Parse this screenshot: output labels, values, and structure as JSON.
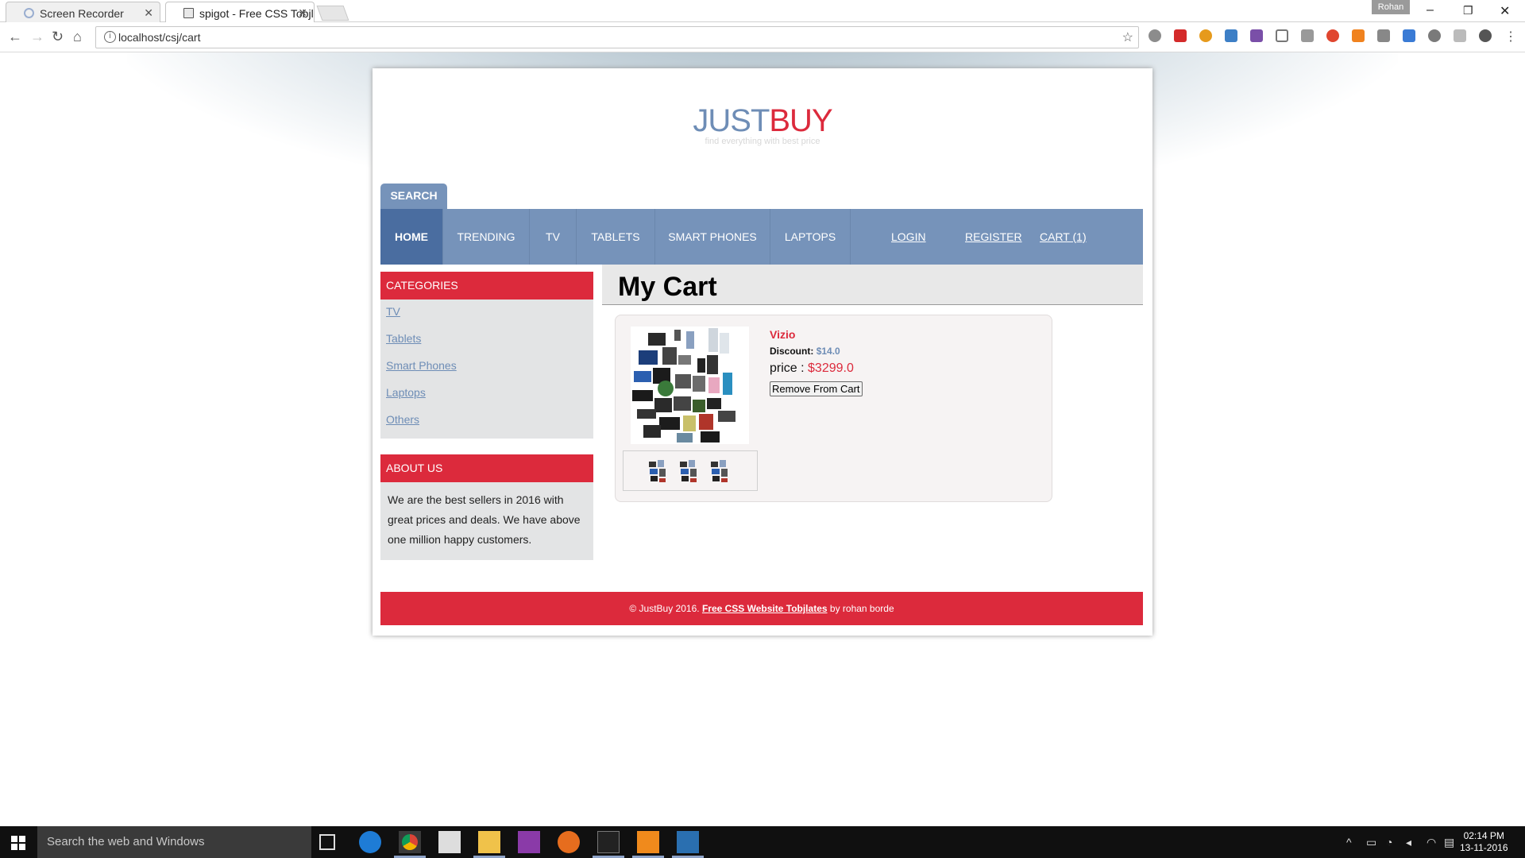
{
  "browser": {
    "tabs": [
      {
        "title": "Screen Recorder",
        "active": false
      },
      {
        "title": "spigot - Free CSS Tobjlat",
        "active": true
      }
    ],
    "profile": "Rohan",
    "url": "localhost/csj/cart"
  },
  "site": {
    "logo_part1": "JUST",
    "logo_part2": "BUY",
    "tagline": "find everything with best price",
    "search_label": "SEARCH",
    "menu": {
      "home": "HOME",
      "trending": "TRENDING",
      "tv": "TV",
      "tablets": "TABLETS",
      "smart_phones": "SMART PHONES",
      "laptops": "LAPTOPS",
      "login": "LOGIN",
      "register": "REGISTER",
      "cart": "CART (1)"
    },
    "sidebar": {
      "categories_title": "CATEGORIES",
      "categories": [
        "TV",
        "Tablets",
        "Smart Phones",
        "Laptops",
        "Others"
      ],
      "about_title": "ABOUT US",
      "about_text": "We are the best sellers in 2016 with great prices and deals. We have above one million happy customers."
    },
    "cart": {
      "title": "My Cart",
      "product": {
        "name": "Vizio",
        "discount_label": "Discount:",
        "discount_value": "$14.0",
        "price_label": "price : ",
        "price_value": "$3299.0",
        "remove_label": "Remove From Cart"
      }
    },
    "footer": {
      "copyright": "© JustBuy 2016.",
      "link_text": "Free CSS Website Tobjlates",
      "by_text": "by rohan borde"
    }
  },
  "taskbar": {
    "search_placeholder": "Search the web and Windows",
    "time": "02:14 PM",
    "date": "13-11-2016"
  },
  "colors": {
    "brand_blue": "#7693ba",
    "brand_red": "#dc2a3c",
    "active_menu": "#4a6da0"
  }
}
